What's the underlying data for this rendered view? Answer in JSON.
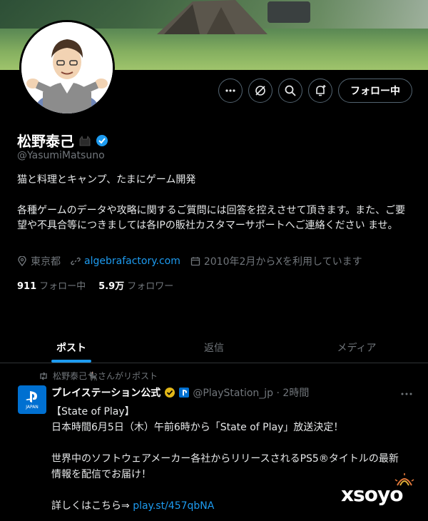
{
  "profile": {
    "name": "松野泰己",
    "handle": "@YasumiMatsuno",
    "bio_line1": "猫と料理とキャンプ、たまにゲーム開発",
    "bio_line2": "各種ゲームのデータや攻略に関するご質問には回答を控えさせて頂きます。また、ご要望や不具合等につきましては各IPの販社カスタマーサポートへご連絡ください ませ。",
    "location": "東京都",
    "website": "algebrafactory.com",
    "joined": "2010年2月からXを利用しています",
    "following_count": "911",
    "following_label": "フォロー中",
    "followers_count": "5.9万",
    "followers_label": "フォロワー"
  },
  "actions": {
    "follow_label": "フォロー中",
    "more_icon": "more-icon",
    "grok_icon": "grok-icon",
    "search_icon": "search-icon",
    "notify_icon": "bell-plus-icon"
  },
  "tabs": [
    {
      "label": "ポスト",
      "active": true
    },
    {
      "label": "返信",
      "active": false
    },
    {
      "label": "メディア",
      "active": false
    }
  ],
  "post": {
    "repost_text": "松野泰己🐈‍⬛さんがリポスト",
    "author": "プレイステーション公式",
    "handle_time": "@PlayStation_jp · 2時間",
    "avatar_sub": "JAPAN",
    "line1": "【State of Play】",
    "line2": "日本時間6月5日（木）午前6時から「State of Play」放送決定！",
    "line3": "世界中のソフトウェアメーカー各社からリリースされるPS5®タイトルの最新",
    "line4": "情報を配信でお届け！",
    "line5_prefix": "詳しくはこちら⇒ ",
    "line5_link": "play.st/457qbNA"
  },
  "watermark": "xsoyo",
  "colors": {
    "accent": "#1d9bf0",
    "verified_gold": "#e2b719",
    "background": "#000000"
  }
}
